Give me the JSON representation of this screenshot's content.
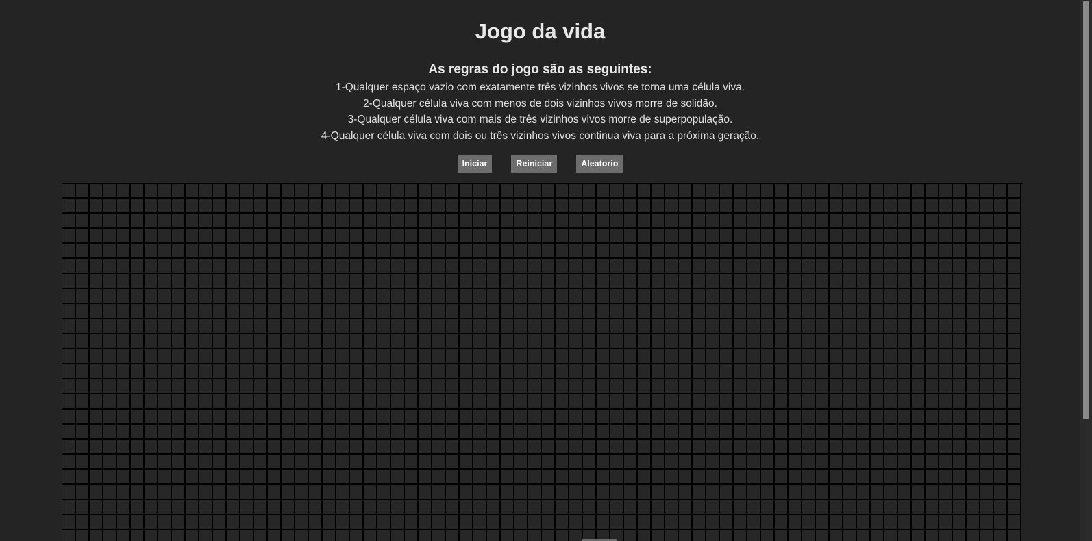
{
  "page": {
    "title": "Jogo da vida",
    "rules_heading": "As regras do jogo são as seguintes:",
    "rules": [
      "1-Qualquer espaço vazio com exatamente três vizinhos vivos se torna uma célula viva.",
      "2-Qualquer célula viva com menos de dois vizinhos vivos morre de solidão.",
      "3-Qualquer célula viva com mais de três vizinhos vivos morre de superpopulação.",
      "4-Qualquer célula viva com dois ou três vizinhos vivos continua viva para a próxima geração."
    ]
  },
  "controls": {
    "start_label": "Iniciar",
    "restart_label": "Reiniciar",
    "random_label": "Aleatorio"
  },
  "grid": {
    "columns": 70,
    "visible_rows": 24,
    "alive_cells": []
  },
  "colors": {
    "background": "#242424",
    "cell_dead": "#272727",
    "cell_border": "#000000",
    "button_bg": "#6d6d6d",
    "text": "#e6e6e6"
  }
}
